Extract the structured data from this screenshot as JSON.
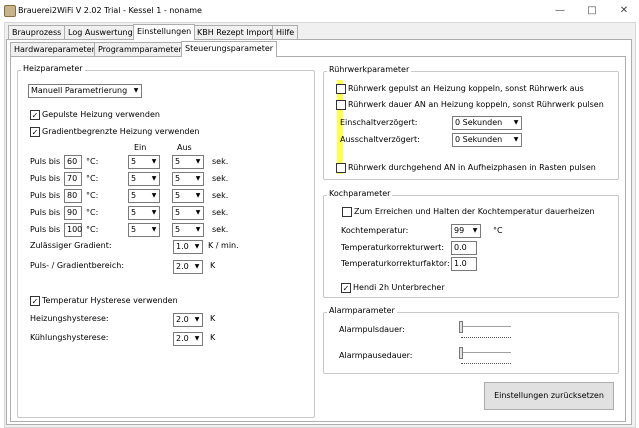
{
  "window": {
    "title": "Brauerei2WiFi V 2.02 Trial - Kessel 1 - noname"
  },
  "main_tabs": [
    "Brauprozess",
    "Log Auswertung",
    "Einstellungen",
    "KBH Rezept Import",
    "Hilfe"
  ],
  "sub_tabs": [
    "Hardwareparameter",
    "Programmparameter",
    "Steuerungsparameter"
  ],
  "heiz": {
    "title": "Heizparameter",
    "mode": "Manuell Parametrierung",
    "gepulste_label": "Gepulste Heizung verwenden",
    "gradient_label": "Gradientbegrenzte Heizung verwenden",
    "col_ein": "Ein",
    "col_aus": "Aus",
    "rows": [
      {
        "label": "Puls bis",
        "temp": "60",
        "unit": "°C:",
        "ein": "5",
        "aus": "5",
        "sek": "sek."
      },
      {
        "label": "Puls bis",
        "temp": "70",
        "unit": "°C:",
        "ein": "5",
        "aus": "5",
        "sek": "sek."
      },
      {
        "label": "Puls bis",
        "temp": "80",
        "unit": "°C:",
        "ein": "5",
        "aus": "5",
        "sek": "sek."
      },
      {
        "label": "Puls bis",
        "temp": "90",
        "unit": "°C:",
        "ein": "5",
        "aus": "5",
        "sek": "sek."
      },
      {
        "label": "Puls bis",
        "temp": "100",
        "unit": "°C:",
        "ein": "5",
        "aus": "5",
        "sek": "sek."
      }
    ],
    "gradient_zul_label": "Zulässiger Gradient:",
    "gradient_zul_value": "1.0",
    "gradient_zul_unit": "K / min.",
    "bereich_label": "Puls- / Gradientbereich:",
    "bereich_value": "2.0",
    "bereich_unit": "K",
    "hysterese_label": "Temperatur Hysterese verwenden",
    "heiz_hyst_label": "Heizungshysterese:",
    "heiz_hyst_value": "2.0",
    "heiz_hyst_unit": "K",
    "kuehl_hyst_label": "Kühlungshysterese:",
    "kuehl_hyst_value": "2.0",
    "kuehl_hyst_unit": "K"
  },
  "ruehr": {
    "title": "Rührwerkparameter",
    "opt1": "Rührwerk gepulst an Heizung koppeln, sonst Rührwerk aus",
    "opt2": "Rührwerk dauer AN an Heizung koppeln, sonst Rührwerk pulsen",
    "ein_label": "Einschaltverzögert:",
    "ein_value": "0 Sekunden",
    "aus_label": "Ausschaltverzögert:",
    "aus_value": "0 Sekunden",
    "opt3": "Rührwerk durchgehend AN in Aufheizphasen in Rasten pulsen"
  },
  "koch": {
    "title": "Kochparameter",
    "opt1": "Zum Erreichen und Halten der Kochtemperatur dauerheizen",
    "temp_label": "Kochtemperatur:",
    "temp_value": "99",
    "temp_unit": "°C",
    "korr_wert_label": "Temperaturkorrekturwert:",
    "korr_wert_value": "0.0",
    "korr_faktor_label": "Temperaturkorrekturfaktor:",
    "korr_faktor_value": "1.0",
    "hendi_label": "Hendi 2h Unterbrecher"
  },
  "alarm": {
    "title": "Alarmparameter",
    "puls_label": "Alarmpulsdauer:",
    "pause_label": "Alarmpausedauer:"
  },
  "reset_button": "Einstellungen zurücksetzen",
  "colors": {
    "highlight": "#ffff33",
    "tab_border": "#adadad"
  },
  "icons": {
    "minimize": "minimize-icon",
    "maximize": "maximize-icon",
    "close": "close-icon"
  }
}
